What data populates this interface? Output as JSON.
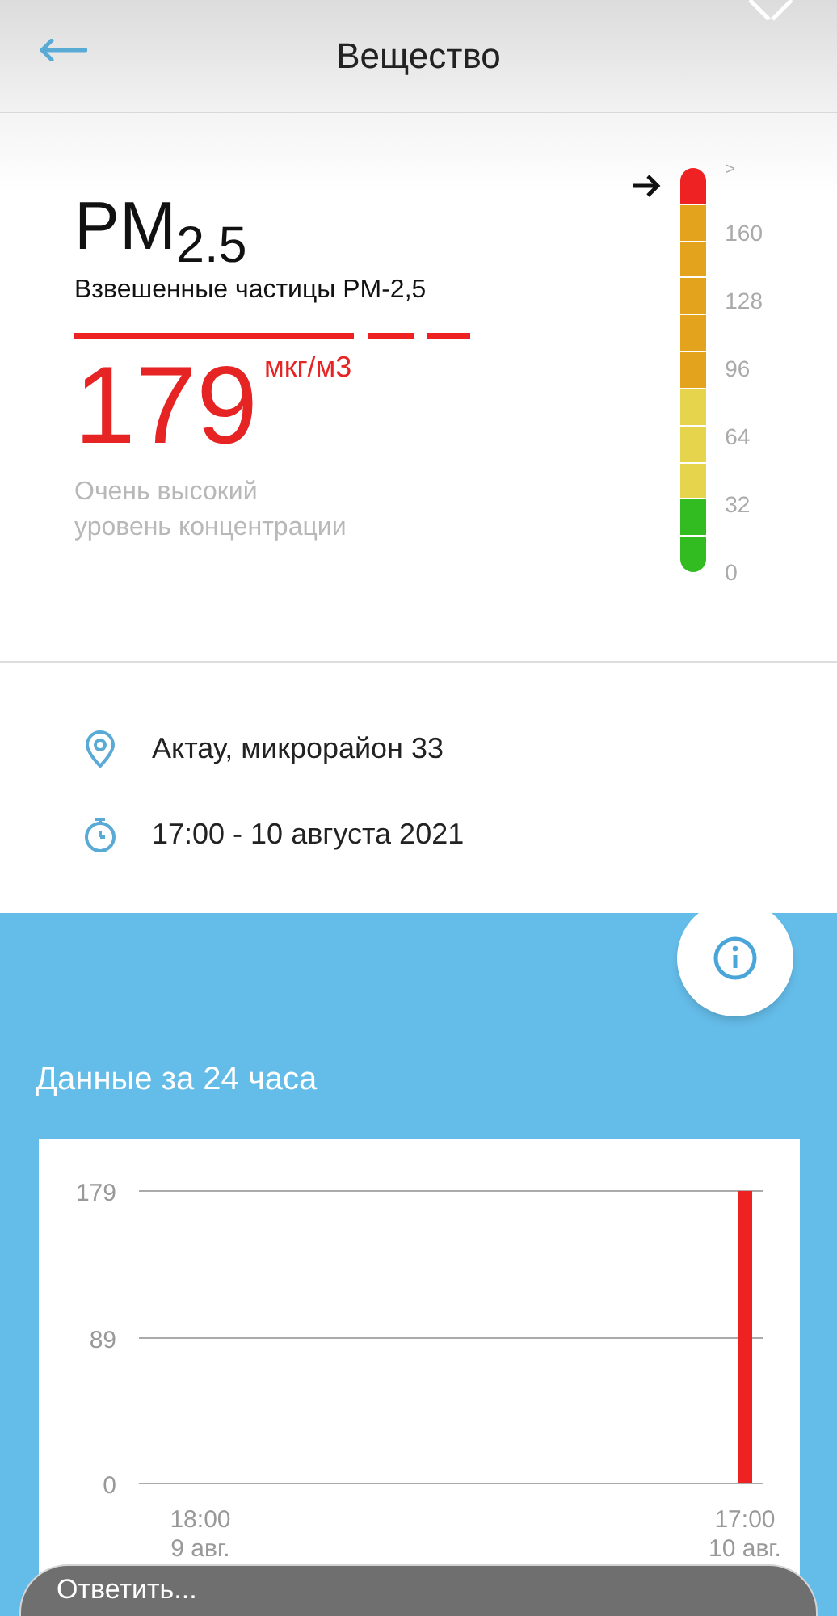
{
  "header": {
    "title": "Вещество"
  },
  "substance": {
    "symbol": "PM",
    "subscript": "2.5",
    "name": "Взвешенные частицы PM-2,5",
    "value": "179",
    "unit": "мкг/м3",
    "level_text": [
      "Очень высокий",
      "уровень концентрации"
    ]
  },
  "scale": {
    "labels": [
      ">",
      "160",
      "128",
      "96",
      "64",
      "32",
      "0"
    ],
    "segments": [
      {
        "color": "#ee2222",
        "selected": true
      },
      {
        "color": "#e3a31d",
        "selected": false
      },
      {
        "color": "#e3a31d",
        "selected": false
      },
      {
        "color": "#e3a31d",
        "selected": false
      },
      {
        "color": "#e3a31d",
        "selected": false
      },
      {
        "color": "#e3a31d",
        "selected": false
      },
      {
        "color": "#e6d54c",
        "selected": false
      },
      {
        "color": "#e6d54c",
        "selected": false
      },
      {
        "color": "#e6d54c",
        "selected": false
      },
      {
        "color": "#33bb22",
        "selected": false
      },
      {
        "color": "#33bb22",
        "selected": false
      }
    ]
  },
  "details": [
    {
      "kind": "location",
      "text": "Актау, микрорайон 33"
    },
    {
      "kind": "time",
      "text": "17:00 - 10 августа 2021"
    }
  ],
  "history": {
    "title": "Данные за 24 часа",
    "chart_data": {
      "type": "bar",
      "categories": [
        "18:00 9 авг.",
        null,
        null,
        null,
        null,
        null,
        null,
        null,
        null,
        null,
        null,
        null,
        null,
        null,
        null,
        null,
        null,
        null,
        null,
        null,
        null,
        null,
        null,
        "17:00 10 авг."
      ],
      "series": [
        {
          "color": "#ee2222",
          "values": [
            null,
            null,
            null,
            null,
            null,
            null,
            null,
            null,
            null,
            null,
            null,
            null,
            null,
            null,
            null,
            null,
            null,
            null,
            null,
            null,
            null,
            null,
            null,
            179
          ]
        }
      ],
      "ylim": [
        0,
        179
      ],
      "yticks": [
        0,
        89,
        179
      ]
    }
  },
  "reply": {
    "placeholder": "Ответить..."
  }
}
